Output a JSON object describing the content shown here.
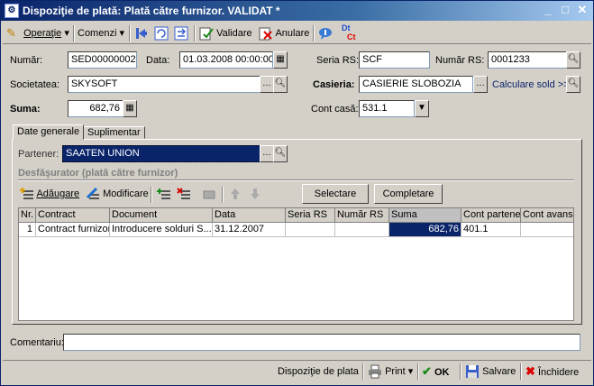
{
  "window": {
    "title": "Dispoziţie de plată: Plată către furnizor. VALIDAT *",
    "icon_label": "⚙"
  },
  "toolbar": {
    "operatie_label": "Operaţie",
    "comenzi_label": "Comenzi",
    "validare_label": "Validare",
    "anulare_label": "Anulare",
    "dtct_top": "Dt",
    "dtct_bottom": "Ct"
  },
  "form": {
    "numar_label": "Număr:",
    "numar_value": "SED00000002",
    "data_label": "Data:",
    "data_value": "01.03.2008 00:00:00",
    "seria_rs_label": "Seria RS:",
    "seria_rs_value": "SCF",
    "numar_rs_label": "Număr RS:",
    "numar_rs_value": "0001233",
    "societatea_label": "Societatea:",
    "societatea_value": "SKYSOFT",
    "casieria_label": "Casieria:",
    "casieria_value": "CASIERIE SLOBOZIA",
    "calculare_sold_label": "Calculare sold >>",
    "suma_label": "Suma:",
    "suma_value": "682,76",
    "cont_casa_label": "Cont casă:",
    "cont_casa_value": "531.1"
  },
  "tabs": [
    {
      "label": "Date generale"
    },
    {
      "label": "Suplimentar"
    }
  ],
  "general": {
    "partener_label": "Partener:",
    "partener_value": "SAATEN UNION",
    "desfasurator_title": "Desfăşurator (plată către furnizor)",
    "adaugare_label": "Adăugare",
    "modificare_label": "Modificare",
    "selectare_label": "Selectare",
    "completare_label": "Completare"
  },
  "grid": {
    "columns": [
      "Nr.",
      "Contract",
      "Document",
      "Data",
      "Seria RS",
      "Număr RS",
      "Suma",
      "Cont partener",
      "Cont avans"
    ],
    "rows": [
      {
        "nr": "1",
        "contract": "Contract furnizor",
        "document": "Introducere solduri S...",
        "data": "31.12.2007",
        "seria_rs": "",
        "numar_rs": "",
        "suma": "682,76",
        "cont_partener": "401.1",
        "cont_avans": ""
      }
    ]
  },
  "comentariu": {
    "label": "Comentariu:",
    "value": ""
  },
  "statusbar": {
    "dispozitie_label": "Dispoziţie de plata",
    "print_label": "Print",
    "ok_label": "OK",
    "salvare_label": "Salvare",
    "inchidere_label": "Închidere"
  },
  "colors": {
    "title_bar": "#0a246a",
    "selection": "#0a246a",
    "link": "#0a246a"
  }
}
